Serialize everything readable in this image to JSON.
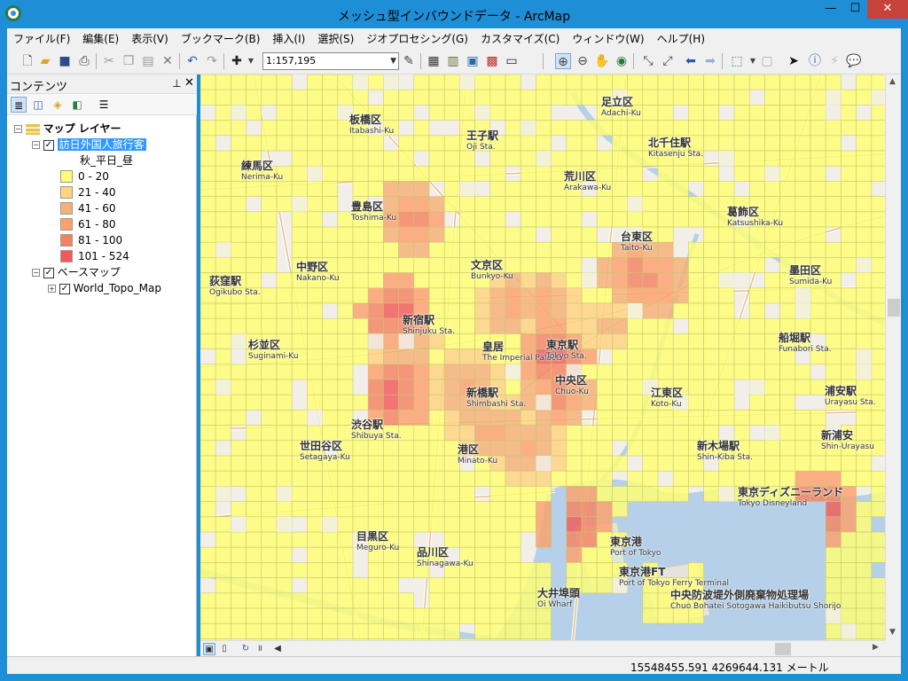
{
  "window": {
    "title": "メッシュ型インバウンドデータ - ArcMap"
  },
  "menu": [
    "ファイル(F)",
    "編集(E)",
    "表示(V)",
    "ブックマーク(B)",
    "挿入(I)",
    "選択(S)",
    "ジオプロセシング(G)",
    "カスタマイズ(C)",
    "ウィンドウ(W)",
    "ヘルプ(H)"
  ],
  "toolbar": {
    "scale": "1:157,195"
  },
  "toc": {
    "title": "コンテンツ",
    "root": "マップ レイヤー",
    "layer1": "訪日外国人旅行客",
    "field": "秋_平日_昼",
    "classes": [
      {
        "label": "0 - 20",
        "color": "#ffff73"
      },
      {
        "label": "21 - 40",
        "color": "#ffd37f"
      },
      {
        "label": "41 - 60",
        "color": "#f5b075"
      },
      {
        "label": "61 - 80",
        "color": "#fca06c"
      },
      {
        "label": "81 - 100",
        "color": "#f48262"
      },
      {
        "label": "101 - 524",
        "color": "#f25a5a"
      }
    ],
    "group2": "ベースマップ",
    "layer2": "World_Topo_Map"
  },
  "map": {
    "labels": [
      {
        "text": "足立区",
        "sub": "Adachi-Ku"
      },
      {
        "text": "北千住駅",
        "sub": "Kitasenju Sta."
      },
      {
        "text": "板橋区",
        "sub": "Itabashi-Ku"
      },
      {
        "text": "練馬区",
        "sub": "Nerima-Ku"
      },
      {
        "text": "豊島区",
        "sub": "Toshima-Ku"
      },
      {
        "text": "王子駅",
        "sub": "Oji Sta."
      },
      {
        "text": "荒川区",
        "sub": "Arakawa-Ku"
      },
      {
        "text": "葛飾区",
        "sub": "Katsushika-Ku"
      },
      {
        "text": "中野区",
        "sub": "Nakano-Ku"
      },
      {
        "text": "文京区",
        "sub": "Bunkyo-Ku"
      },
      {
        "text": "台東区",
        "sub": "Taito-Ku"
      },
      {
        "text": "墨田区",
        "sub": "Sumida-Ku"
      },
      {
        "text": "新宿駅",
        "sub": "Shinjuku Sta."
      },
      {
        "text": "杉並区",
        "sub": "Suginami-Ku"
      },
      {
        "text": "皇居",
        "sub": "The Imperial Palace"
      },
      {
        "text": "東京駅",
        "sub": "Tokyo Sta."
      },
      {
        "text": "中央区",
        "sub": "Chuo-Ku"
      },
      {
        "text": "江東区",
        "sub": "Koto-Ku"
      },
      {
        "text": "新橋駅",
        "sub": "Shimbashi Sta."
      },
      {
        "text": "渋谷駅",
        "sub": "Shibuya Sta."
      },
      {
        "text": "港区",
        "sub": "Minato-Ku"
      },
      {
        "text": "世田谷区",
        "sub": "Setagaya-Ku"
      },
      {
        "text": "新木場駅",
        "sub": "Shin-Kiba Sta."
      },
      {
        "text": "東京ディズニーランド",
        "sub": "Tokyo Disneyland"
      },
      {
        "text": "目黒区",
        "sub": "Meguro-Ku"
      },
      {
        "text": "品川区",
        "sub": "Shinagawa-Ku"
      },
      {
        "text": "東京港",
        "sub": "Port of Tokyo"
      },
      {
        "text": "東京港FT",
        "sub": "Port of Tokyo Ferry Terminal"
      },
      {
        "text": "大井埠頭",
        "sub": "Oi Wharf"
      },
      {
        "text": "中央防波堤外側廃棄物処理場",
        "sub": "Chuo Bohatei Sotogawa Haikibutsu Shorijo"
      },
      {
        "text": "船堀駅",
        "sub": "Funabori Sta."
      },
      {
        "text": "浦安駅",
        "sub": "Urayasu Sta."
      },
      {
        "text": "新浦安",
        "sub": "Shin-Urayasu"
      },
      {
        "text": "荻窪駅",
        "sub": "Ogikubo Sta."
      }
    ]
  },
  "status": {
    "coords": "15548455.591  4269644.131 メートル"
  }
}
